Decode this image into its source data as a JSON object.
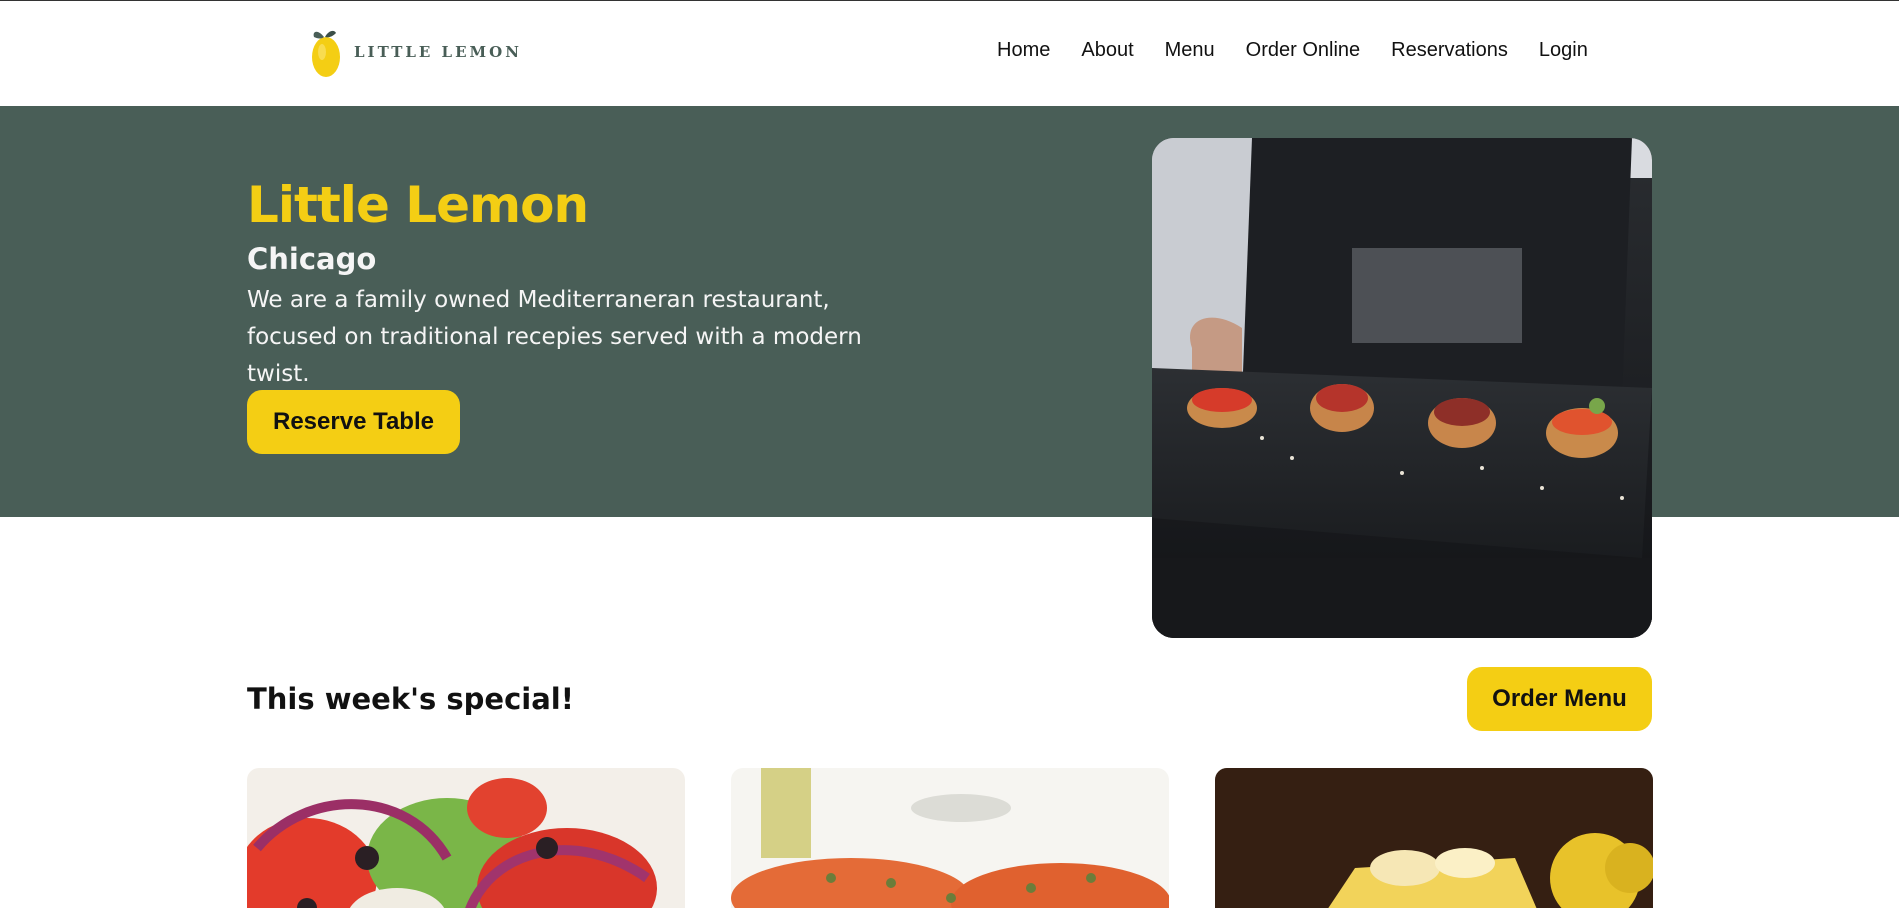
{
  "brand": {
    "logo_text": "LITTLE LEMON",
    "icon": "lemon-logo-icon",
    "colors": {
      "primary_green": "#495e57",
      "primary_yellow": "#f4ce14"
    }
  },
  "nav": {
    "items": [
      {
        "label": "Home"
      },
      {
        "label": "About"
      },
      {
        "label": "Menu"
      },
      {
        "label": "Order Online"
      },
      {
        "label": "Reservations"
      },
      {
        "label": "Login"
      }
    ]
  },
  "hero": {
    "title": "Little Lemon",
    "city": "Chicago",
    "description": "We are a family owned Mediterraneran restaurant, focused on traditional recepies served with a modern twist.",
    "cta_label": "Reserve Table",
    "image": "bruschetta-serving-photo"
  },
  "specials": {
    "title": "This week's special!",
    "order_label": "Order Menu",
    "cards": [
      {
        "image": "greek-salad-photo"
      },
      {
        "image": "bruschetta-photo"
      },
      {
        "image": "lemon-dessert-photo"
      }
    ]
  }
}
